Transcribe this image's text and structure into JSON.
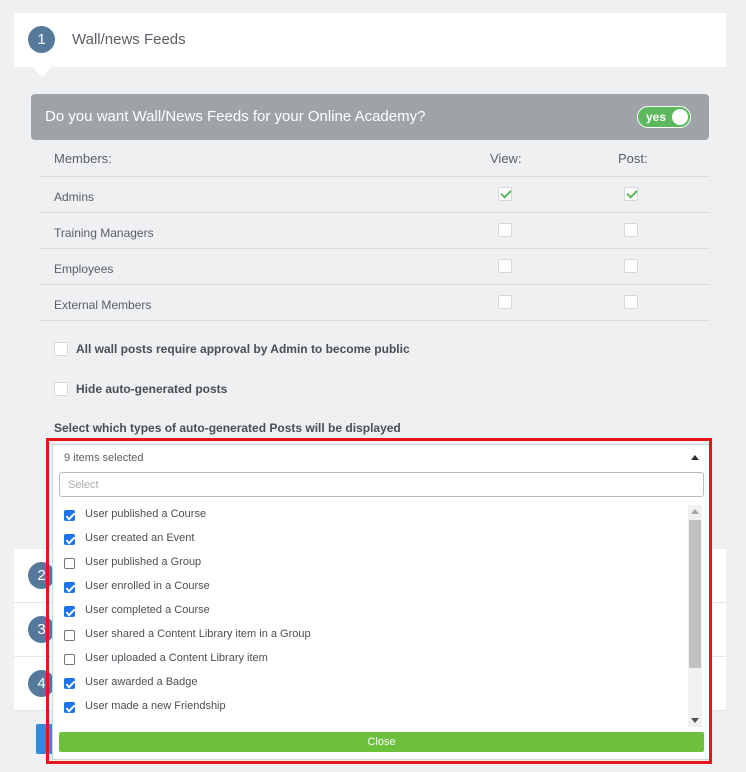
{
  "step1": {
    "number": "1",
    "title": "Wall/news Feeds"
  },
  "question": {
    "text": "Do you want Wall/News Feeds for your Online Academy?",
    "toggle_label": "yes",
    "toggle_on": true
  },
  "permissions": {
    "members_header": "Members:",
    "view_header": "View:",
    "post_header": "Post:",
    "rows": [
      {
        "name": "Admins",
        "view": true,
        "post": true
      },
      {
        "name": "Training Managers",
        "view": false,
        "post": false
      },
      {
        "name": "Employees",
        "view": false,
        "post": false
      },
      {
        "name": "External Members",
        "view": false,
        "post": false
      }
    ]
  },
  "options": {
    "approval_label": "All wall posts require approval by Admin to become public",
    "approval_checked": false,
    "hide_auto_label": "Hide auto-generated posts",
    "hide_auto_checked": false
  },
  "post_types": {
    "section_label": "Select which types of auto-generated Posts will be displayed",
    "summary": "9 items selected",
    "search_placeholder": "Select",
    "items": [
      {
        "label": "User published a Course",
        "checked": true
      },
      {
        "label": "User created an Event",
        "checked": true
      },
      {
        "label": "User published a Group",
        "checked": false
      },
      {
        "label": "User enrolled in a Course",
        "checked": true
      },
      {
        "label": "User completed a Course",
        "checked": true
      },
      {
        "label": "User shared a Content Library item in a Group",
        "checked": false
      },
      {
        "label": "User uploaded a Content Library item",
        "checked": false
      },
      {
        "label": "User awarded a Badge",
        "checked": true
      },
      {
        "label": "User made a new Friendship",
        "checked": true
      }
    ],
    "close_label": "Close"
  },
  "lower_steps": [
    {
      "number": "2"
    },
    {
      "number": "3"
    },
    {
      "number": "4"
    }
  ],
  "colors": {
    "accent_green": "#5cb85c",
    "close_green": "#6cc03b",
    "step_blue": "#54799a",
    "highlight_red": "#e3161b",
    "checkbox_blue": "#1a73e8"
  }
}
